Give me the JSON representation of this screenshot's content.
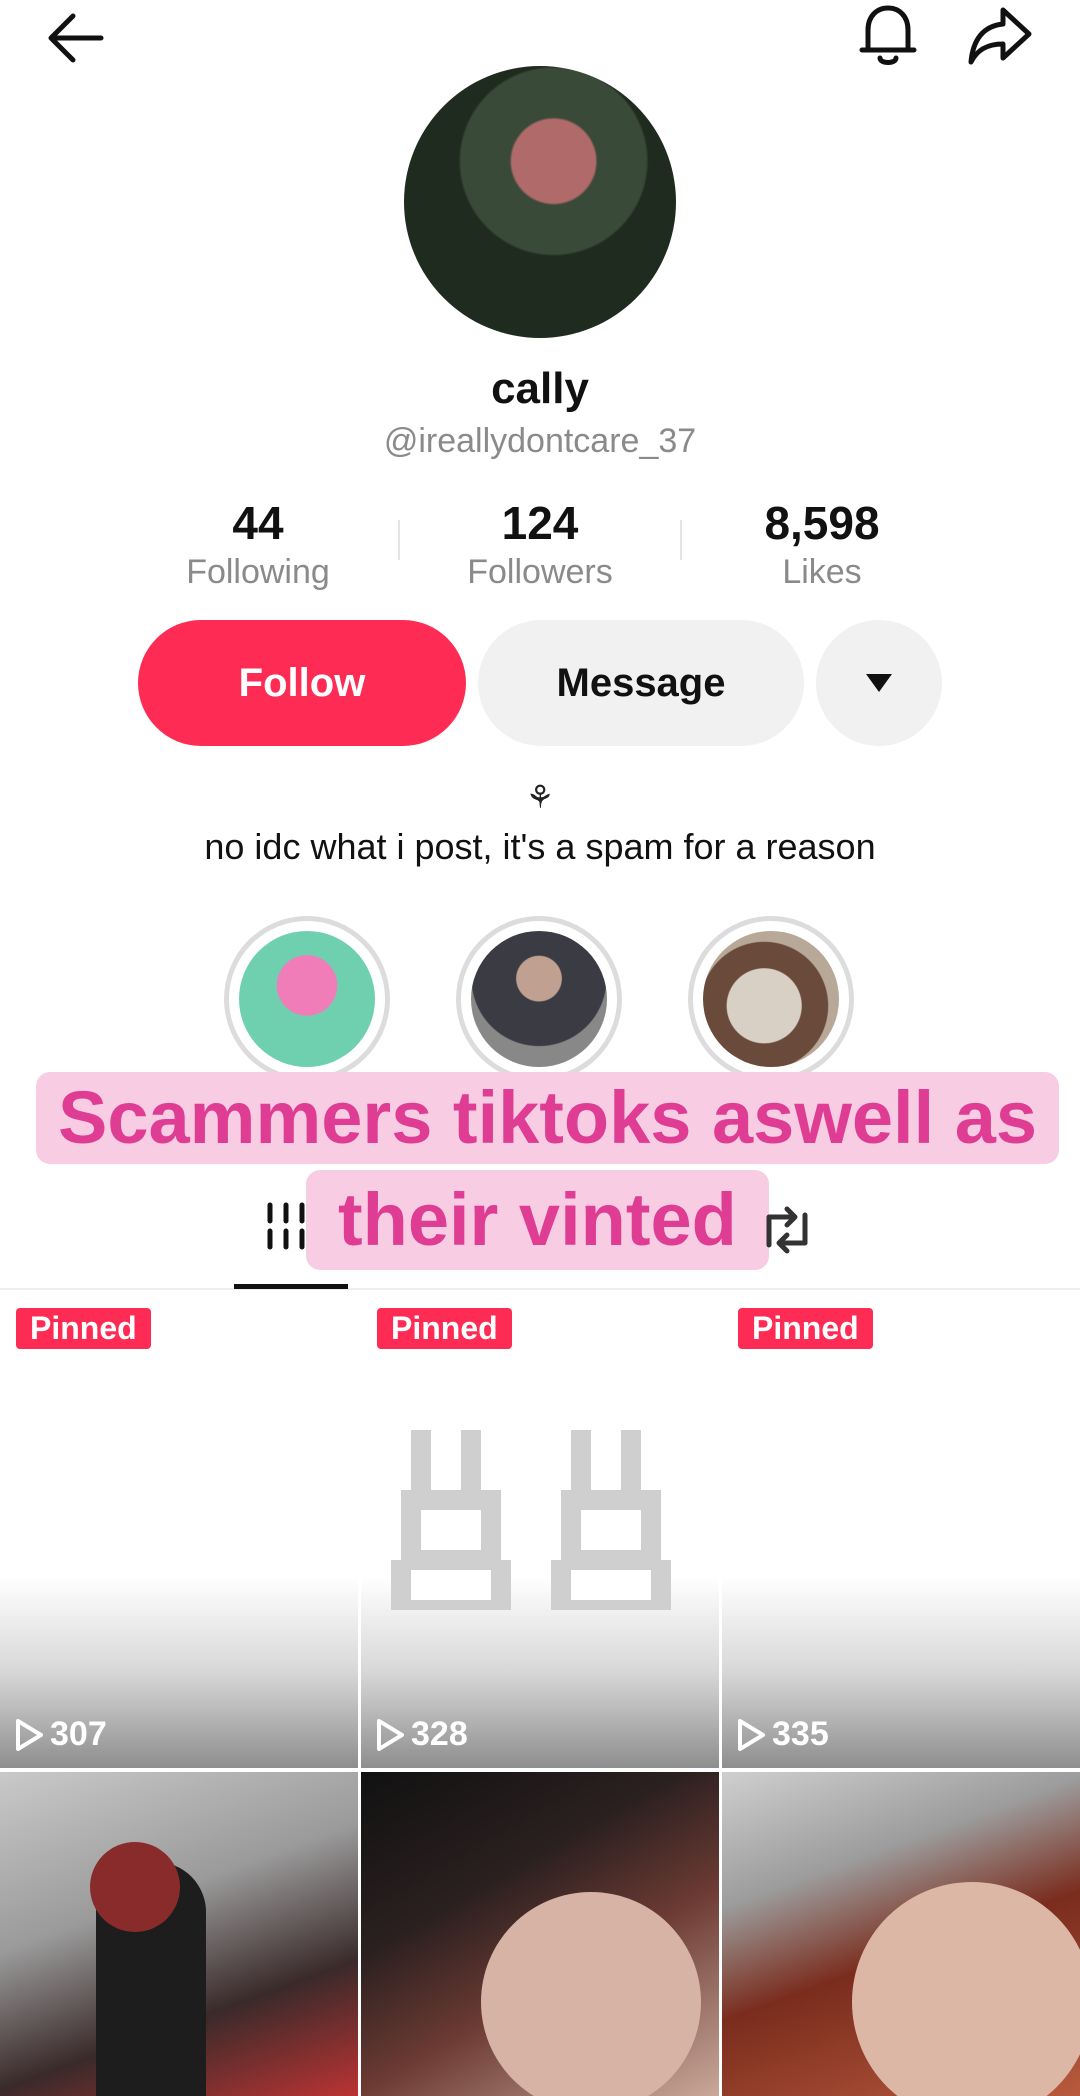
{
  "topbar": {
    "back_icon": "arrow-left-icon",
    "notify_icon": "bell-icon",
    "share_icon": "share-icon"
  },
  "profile": {
    "display_name": "cally",
    "handle": "@ireallydontcare_37",
    "stats": [
      {
        "value": "44",
        "label": "Following"
      },
      {
        "value": "124",
        "label": "Followers"
      },
      {
        "value": "8,598",
        "label": "Likes"
      }
    ],
    "bio_symbol": "⚘",
    "bio": "no idc what i post, it's a spam for a reason"
  },
  "actions": {
    "follow_label": "Follow",
    "message_label": "Message",
    "more_icon": "caret-down-icon"
  },
  "caption": {
    "line1": "Scammers tiktoks aswell as",
    "line2": "their vinted"
  },
  "tabs": {
    "videos_icon": "grid-icon",
    "reposts_icon": "repost-icon"
  },
  "videos": [
    {
      "pinned": "Pinned",
      "views": "307"
    },
    {
      "pinned": "Pinned",
      "views": "328"
    },
    {
      "pinned": "Pinned",
      "views": "335"
    }
  ],
  "colors": {
    "accent": "#fe2c55",
    "caption_bg": "#f8cde3",
    "caption_text": "#de3d93"
  }
}
